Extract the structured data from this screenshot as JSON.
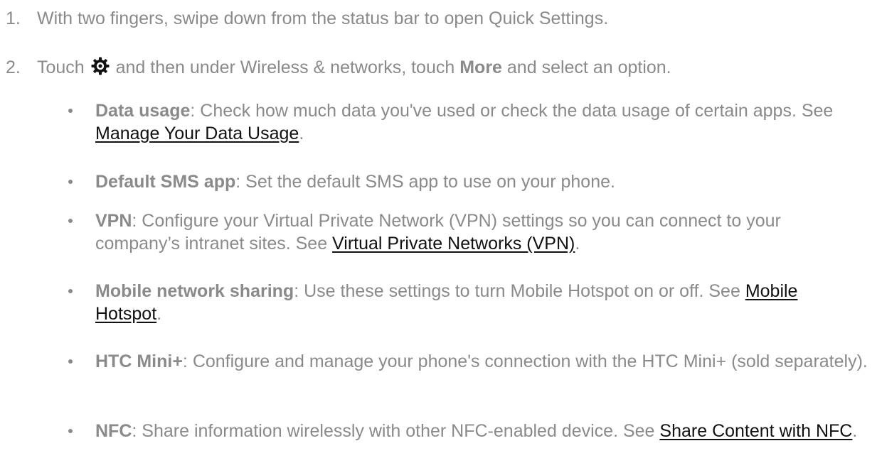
{
  "steps": [
    {
      "number": "1.",
      "text": "With two fingers, swipe down from the status bar to open Quick Settings."
    },
    {
      "number": "2.",
      "prefix": "Touch",
      "icon": "settings-gear-icon",
      "middle": "and then under Wireless & networks, touch",
      "bold": "More",
      "suffix": "and select an option."
    }
  ],
  "options": [
    {
      "term": "Data usage",
      "description": ": Check how much data you've used or check the data usage of certain apps. See ",
      "link": "Manage Your Data Usage",
      "end": "."
    },
    {
      "term": "Default SMS app",
      "description": ": Set the default SMS app to use on your phone.",
      "link": "",
      "end": ""
    },
    {
      "term": "VPN",
      "description": ": Configure your Virtual Private Network (VPN) settings so you can connect to your company’s intranet sites. See ",
      "link": "Virtual Private Networks (VPN)",
      "end": "."
    },
    {
      "term": "Mobile network sharing",
      "description": ": Use these settings to turn Mobile Hotspot on or off. See ",
      "link": "Mobile Hotspot",
      "end": "."
    },
    {
      "term": "HTC Mini+",
      "description": ": Configure and manage your phone's connection with the HTC Mini+ (sold separately).",
      "link": "",
      "end": ""
    },
    {
      "term": "NFC",
      "description": ": Share information wirelessly with other NFC-enabled device. See ",
      "link": "Share Content with NFC",
      "end": "."
    }
  ]
}
